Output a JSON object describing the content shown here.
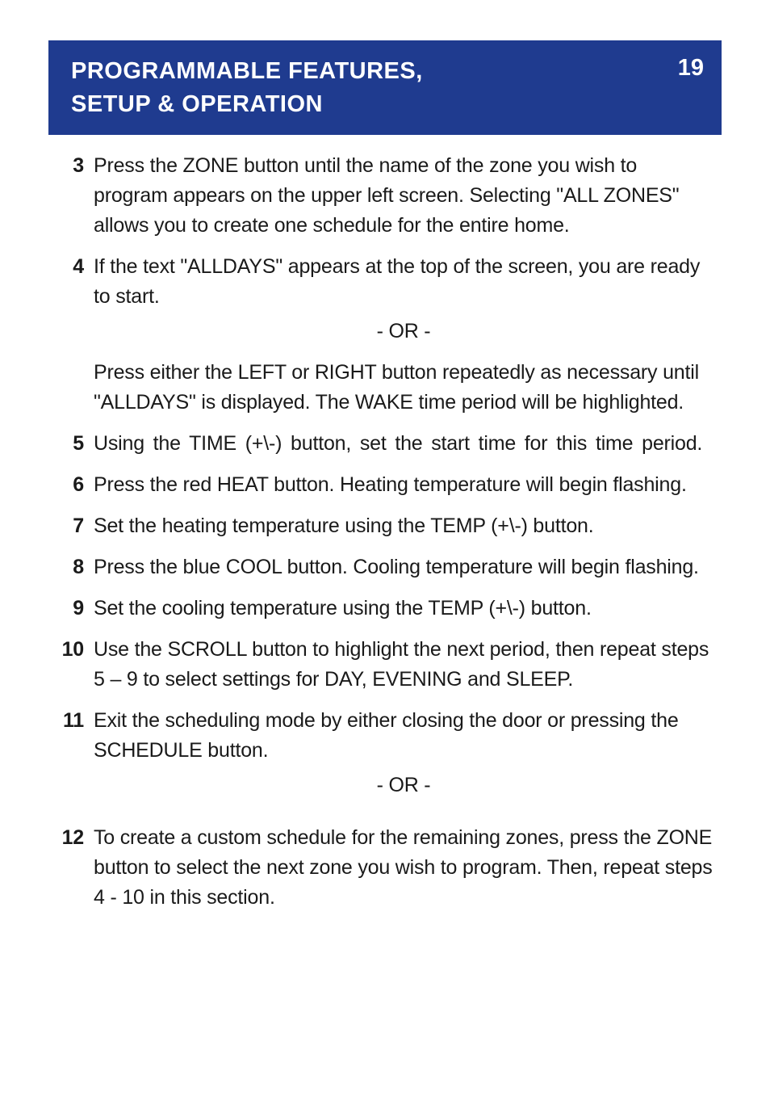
{
  "header": {
    "title_line1": "PROGRAMMABLE FEATURES,",
    "title_line2": "SETUP & OPERATION",
    "page_number": "19"
  },
  "steps": [
    {
      "num": "3",
      "text": "Press the ZONE button until the name of the zone you wish to program appears on the upper left screen. Selecting \"ALL ZONES\" allows you to create one schedule for the entire home."
    },
    {
      "num": "4",
      "text": "If the text \"ALLDAYS\" appears at the top of the screen, you are ready to start.",
      "or_after": true,
      "text2": "Press either the LEFT or RIGHT button repeatedly as necessary until \"ALLDAYS\" is displayed. The WAKE time period will be high­lighted."
    },
    {
      "num": "5",
      "text": "Using the TIME (+\\-) button, set the start time for this time period.",
      "spaced": true
    },
    {
      "num": "6",
      "text": "Press the red HEAT button. Heating temperature will begin flashing."
    },
    {
      "num": "7",
      "text": "Set the heating temperature using the TEMP (+\\-) button."
    },
    {
      "num": "8",
      "text": "Press the blue COOL button. Cooling temperature will begin flashing."
    },
    {
      "num": "9",
      "text": "Set the cooling temperature using the TEMP (+\\-) button."
    },
    {
      "num": "10",
      "text": "Use the SCROLL button to highlight the next period, then repeat steps 5 – 9 to select settings for DAY, EVENING and SLEEP."
    },
    {
      "num": "11",
      "text": "Exit the scheduling mode by either closing the door or pressing the SCHEDULE button.",
      "or_after": true
    },
    {
      "num": "12",
      "text": "To create a custom schedule for the remaining zones, press the ZONE button to select the next zone you wish to program. Then, repeat steps 4 - 10 in this section."
    }
  ],
  "or_label": "- OR -"
}
